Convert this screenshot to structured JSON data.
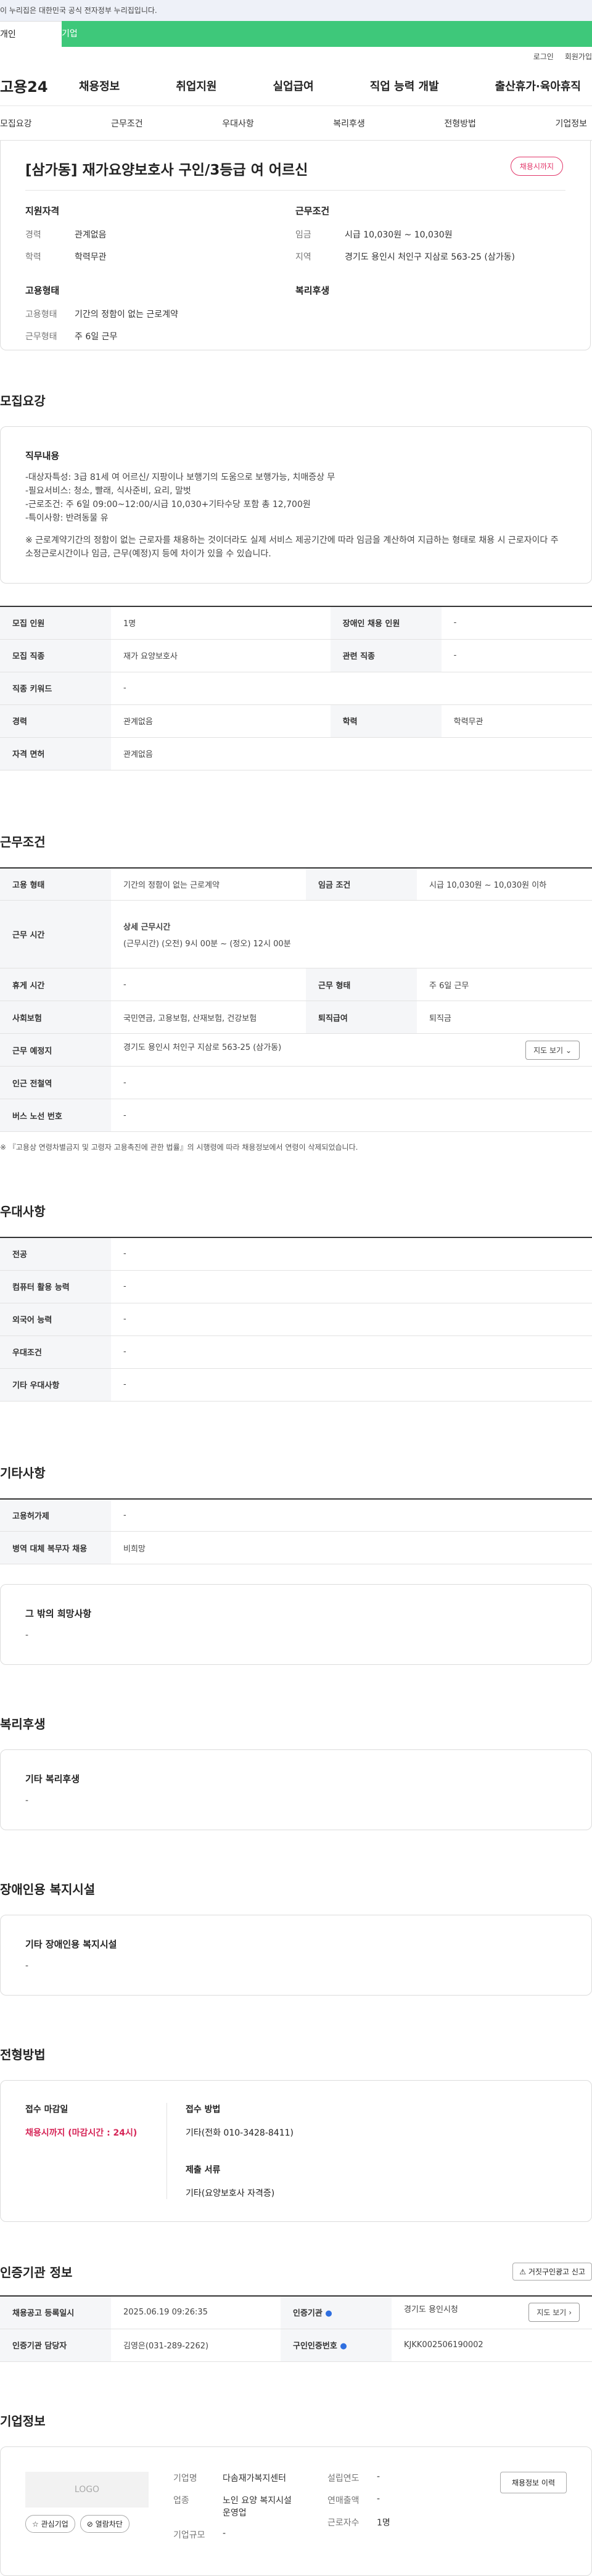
{
  "gov_banner": "이 누리집은 대한민국 공식 전자정부 누리집입니다.",
  "user_tabs": [
    "개인",
    "기업"
  ],
  "util_links": [
    "로그인",
    "회원가입"
  ],
  "logo": "고용24",
  "gnb": [
    "채용정보",
    "취업지원",
    "실업급여",
    "직업 능력 개발",
    "출산휴가·육아휴직"
  ],
  "subnav": [
    "모집요강",
    "근무조건",
    "우대사항",
    "복리후생",
    "전형방법",
    "기업정보"
  ],
  "job": {
    "title": "[삼가동] 재가요양보호사 구인/3등급 여 어르신",
    "badge": "채용시까지",
    "qual_title": "지원자격",
    "qual": [
      {
        "k": "경력",
        "v": "관계없음"
      },
      {
        "k": "학력",
        "v": "학력무관"
      }
    ],
    "cond_title": "근무조건",
    "cond": [
      {
        "k": "임금",
        "v": "시급 10,030원 ~ 10,030원"
      },
      {
        "k": "지역",
        "v": "경기도 용인시 처인구 지삼로 563-25 (삼가동)"
      }
    ],
    "emp_title": "고용형태",
    "emp": [
      {
        "k": "고용형태",
        "v": "기간의 정함이 없는 근로계약"
      },
      {
        "k": "근무형태",
        "v": "주 6일 근무"
      }
    ],
    "welfare_title": "복리후생"
  },
  "recruit": {
    "heading": "모집요강",
    "duty_title": "직무내용",
    "duty_lines": [
      "-대상자특성: 3급 81세 여 어르신/ 지팡이나 보행기의 도움으로 보행가능, 치매증상 무",
      "-필요서비스: 청소, 빨래, 식사준비, 요리, 말벗",
      "-근로조건: 주 6일 09:00~12:00/시급 10,030+기타수당 포함 총 12,700원",
      "-특이사항: 반려동물 유"
    ],
    "duty_note": "※ 근로계약기간의 정함이 없는 근로자를 채용하는 것이더라도 실제 서비스 제공기간에 따라 임금을 계산하여 지급하는 형태로 채용 시 근로자이다 주 소정근로시간이나 임금, 근무(예정)지 등에 차이가 있을 수 있습니다.",
    "rows": [
      [
        {
          "h": "모집 인원",
          "v": "1명"
        },
        {
          "h": "장애인 채용 인원",
          "v": "-"
        }
      ],
      [
        {
          "h": "모집 직종",
          "v": "재가 요양보호사"
        },
        {
          "h": "관련 직종",
          "v": "-"
        }
      ],
      [
        {
          "h": "직종 키워드",
          "v": "-"
        }
      ],
      [
        {
          "h": "경력",
          "v": "관계없음"
        },
        {
          "h": "학력",
          "v": "학력무관"
        }
      ],
      [
        {
          "h": "자격 면허",
          "v": "관계없음"
        }
      ]
    ]
  },
  "work": {
    "heading": "근무조건",
    "emp_type_h": "고용 형태",
    "emp_type_v": "기간의 정함이 없는 근로계약",
    "wage_h": "임금 조건",
    "wage_v": "시급 10,030원 ~ 10,030원 이하",
    "time_h": "근무 시간",
    "time_sub": "상세 근무시간",
    "time_v": "(근무시간) (오전) 9시 00분 ~ (정오) 12시 00분",
    "rest_h": "휴게 시간",
    "rest_v": "-",
    "form_h": "근무 형태",
    "form_v": "주 6일 근무",
    "ins_h": "사회보험",
    "ins_v": "국민연금, 고용보험, 산재보험, 건강보험",
    "ret_h": "퇴직급여",
    "ret_v": "퇴직금",
    "place_h": "근무 예정지",
    "place_v": "경기도 용인시 처인구 지삼로 563-25 (삼가동)",
    "map_btn": "지도 보기",
    "subway_h": "인근 전철역",
    "subway_v": "-",
    "bus_h": "버스 노선 번호",
    "bus_v": "-",
    "note": "※ 『고용상 연령차별금지 및 고령자 고용촉진에 관한 법률』의 시행령에 따라 채용정보에서 연령이 삭제되었습니다."
  },
  "pref": {
    "heading": "우대사항",
    "rows": [
      {
        "h": "전공",
        "v": "-"
      },
      {
        "h": "컴퓨터 활용 능력",
        "v": "-"
      },
      {
        "h": "외국어 능력",
        "v": "-"
      },
      {
        "h": "우대조건",
        "v": "-"
      },
      {
        "h": "기타 우대사항",
        "v": "-"
      }
    ]
  },
  "etc": {
    "heading": "기타사항",
    "rows": [
      {
        "h": "고용허가제",
        "v": "-"
      },
      {
        "h": "병역 대체 복무자 채용",
        "v": "비희망"
      }
    ],
    "box_title": "그 밖의 희망사항",
    "box_v": "-"
  },
  "welfare": {
    "heading": "복리후생",
    "box_title": "기타 복리후생",
    "box_v": "-"
  },
  "disabled": {
    "heading": "장애인용 복지시설",
    "box_title": "기타 장애인용 복지시설",
    "box_v": "-"
  },
  "process": {
    "heading": "전형방법",
    "deadline_t": "접수 마감일",
    "deadline_v": "채용시까지 (마감시간 : 24시)",
    "method_t": "접수 방법",
    "method_v": "기타(전화 010-3428-8411)",
    "docs_t": "제출 서류",
    "docs_v": "기타(요양보호사 자격증)"
  },
  "cert": {
    "heading": "인증기관 정보",
    "report_btn": "거짓구인광고 신고",
    "reg_h": "채용공고 등록일시",
    "reg_v": "2025.06.19 09:26:35",
    "org_h": "인증기관",
    "org_v": "경기도 용인시청",
    "map_btn": "지도 보기",
    "mgr_h": "인증기관 담당자",
    "mgr_v": "김영은(031-289-2262)",
    "no_h": "구인인증번호",
    "no_v": "KJKK002506190002"
  },
  "company": {
    "heading": "기업정보",
    "logo": "LOGO",
    "fav_btn": "관심기업",
    "block_btn": "열람차단",
    "name_k": "기업명",
    "name_v": "다솜재가복지센터",
    "ind_k": "업종",
    "ind_v": "노인 요양 복지시설 운영업",
    "size_k": "기업규모",
    "size_v": "-",
    "year_k": "설립연도",
    "year_v": "-",
    "sales_k": "연매출액",
    "sales_v": "-",
    "emp_k": "근로자수",
    "emp_v": "1명",
    "hist_btn": "채용정보 이력"
  }
}
